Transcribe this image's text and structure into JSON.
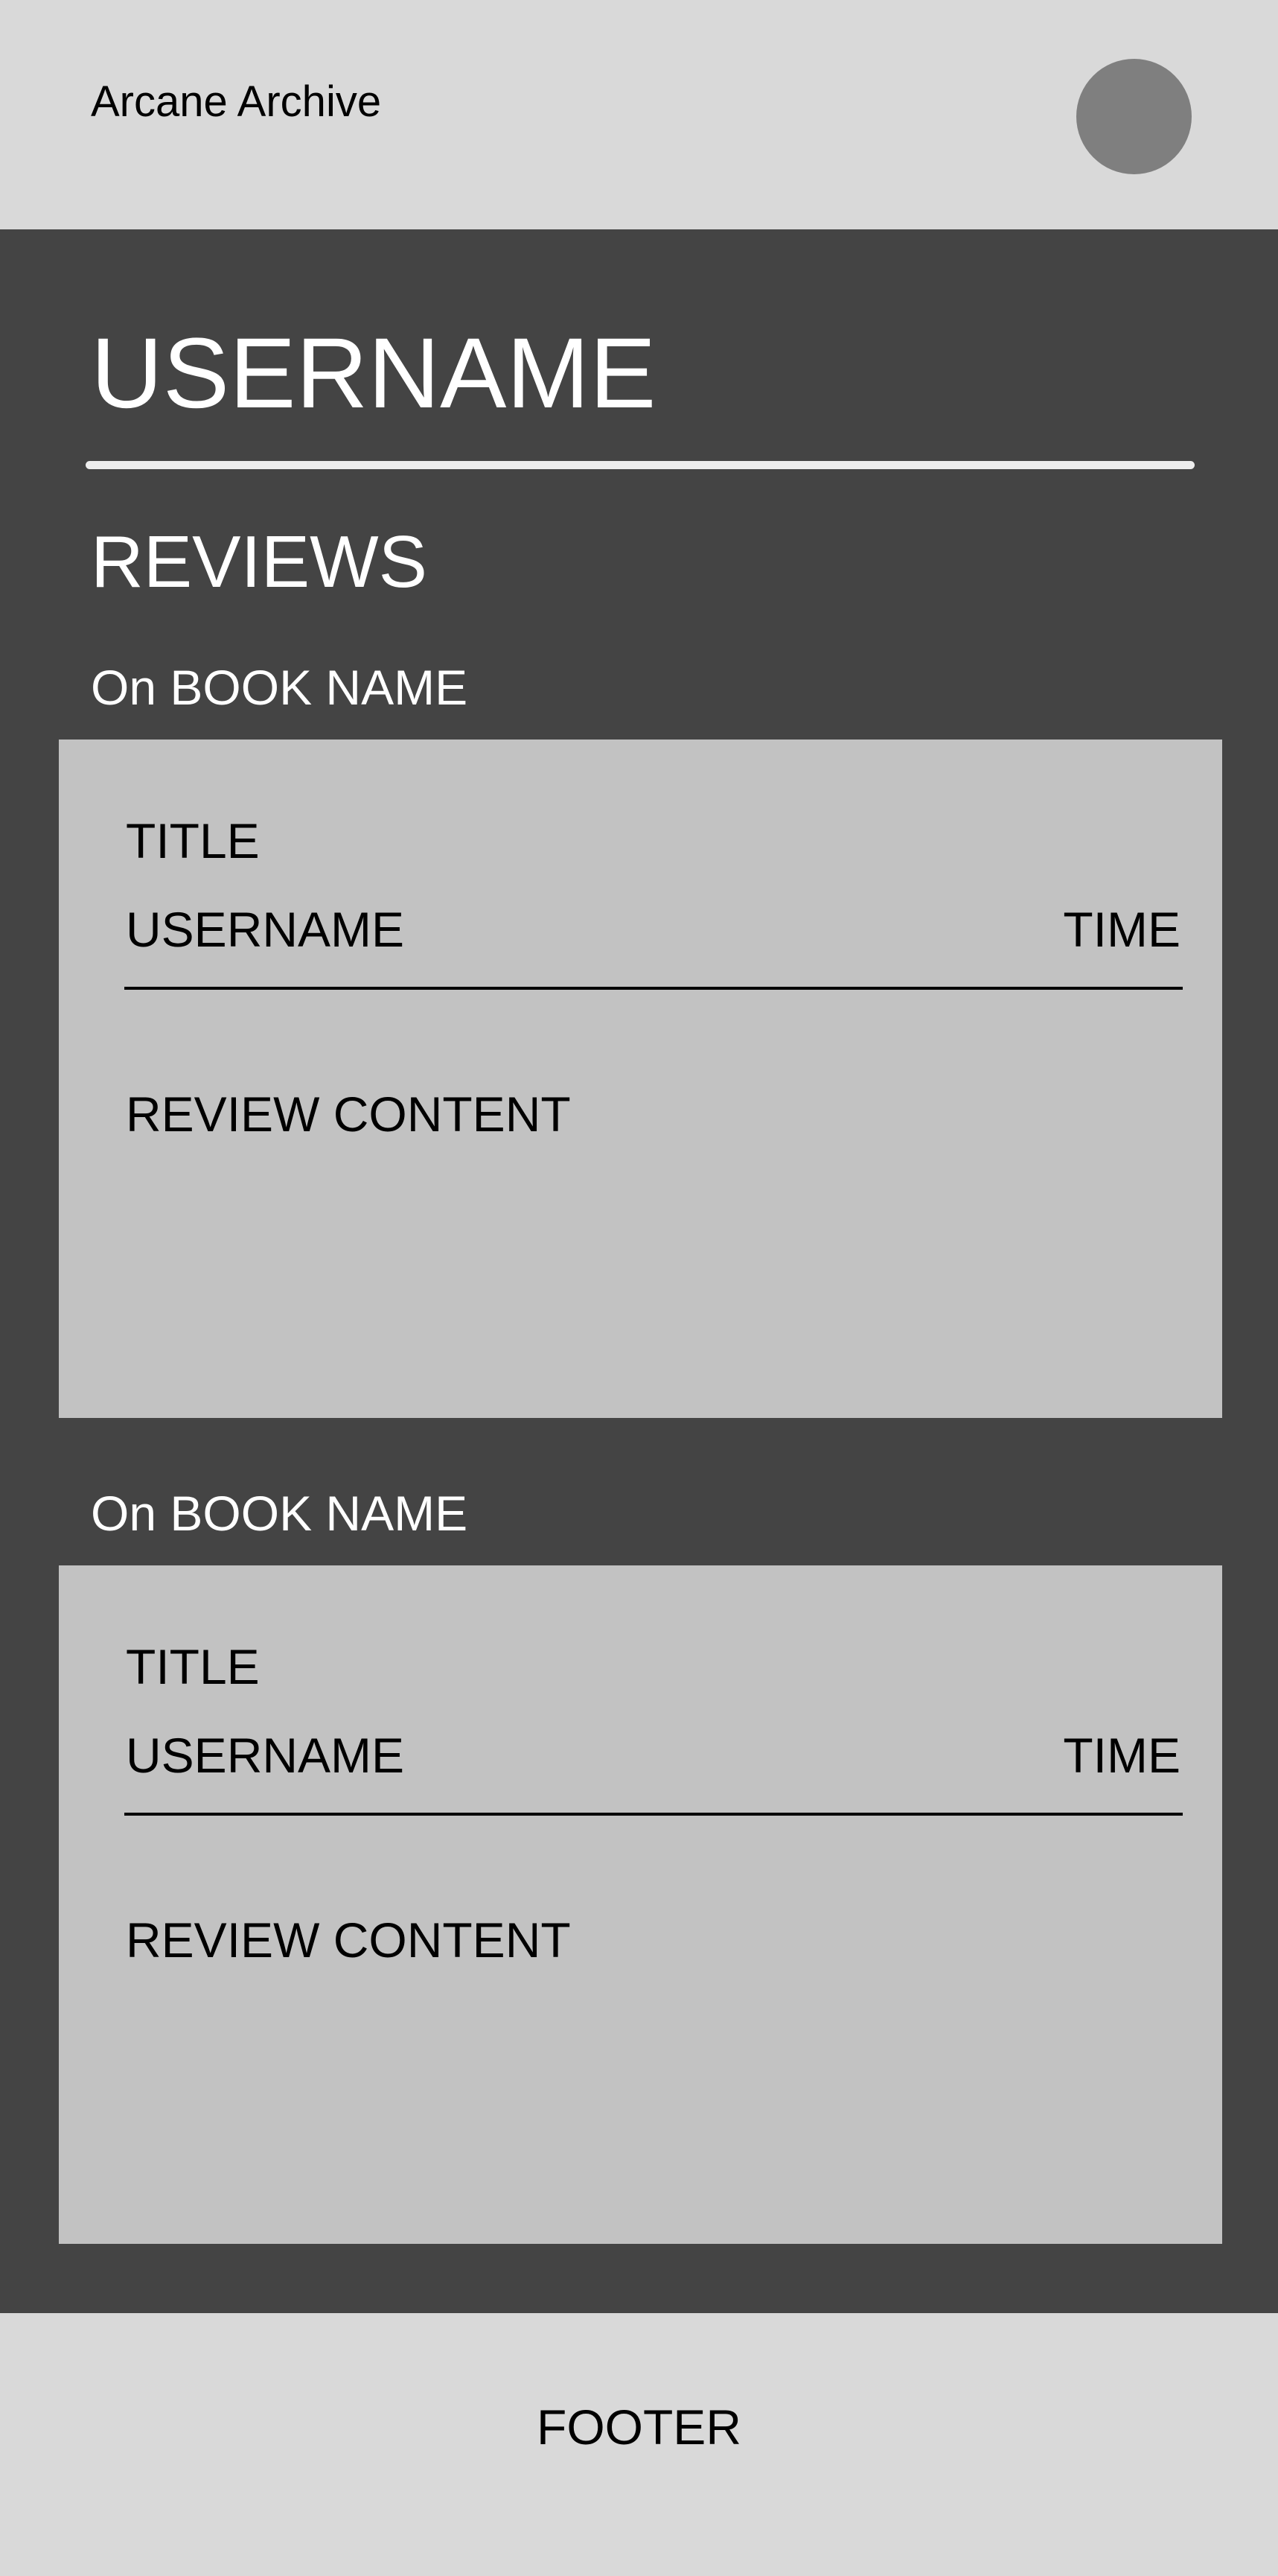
{
  "header": {
    "app_title": "Arcane Archive"
  },
  "profile": {
    "username": "USERNAME",
    "section_title": "REVIEWS"
  },
  "reviews": [
    {
      "book_label": "On BOOK NAME",
      "title": "TITLE",
      "username": "USERNAME",
      "time": "TIME",
      "content": "REVIEW CONTENT"
    },
    {
      "book_label": "On BOOK NAME",
      "title": "TITLE",
      "username": "USERNAME",
      "time": "TIME",
      "content": "REVIEW CONTENT"
    }
  ],
  "footer": {
    "text": "FOOTER"
  },
  "colors": {
    "header_bg": "#d9d9d9",
    "main_bg": "#444444",
    "card_bg": "#c2c2c2",
    "avatar": "#7f7f7f"
  }
}
